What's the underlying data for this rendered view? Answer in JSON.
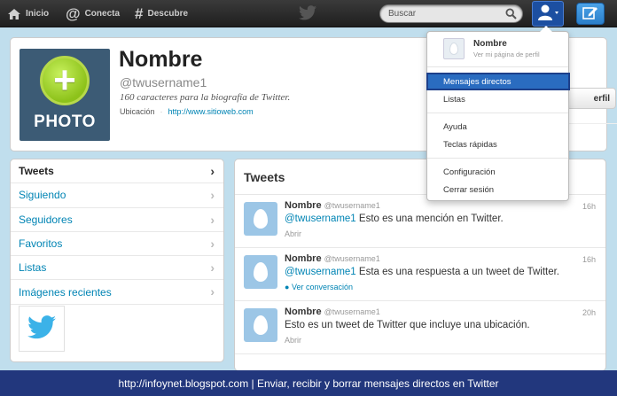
{
  "topbar": {
    "home_label": "Inicio",
    "connect_label": "Conecta",
    "discover_label": "Descubre",
    "search_placeholder": "Buscar"
  },
  "profile": {
    "name": "Nombre",
    "handle": "@twusername1",
    "bio": "160 caracteres para la biografía de Twitter.",
    "location_label": "Ubicación",
    "website": "http://www.sitioweb.com",
    "photo_text": "PHOTO",
    "edit_button": "erfil"
  },
  "sidenav": {
    "items": [
      {
        "label": "Tweets"
      },
      {
        "label": "Siguiendo"
      },
      {
        "label": "Seguidores"
      },
      {
        "label": "Favoritos"
      },
      {
        "label": "Listas"
      },
      {
        "label": "Imágenes recientes"
      }
    ]
  },
  "tweets": {
    "heading": "Tweets",
    "items": [
      {
        "name": "Nombre",
        "handle": "@twusername1",
        "mention": "@twusername1",
        "text": " Esto es una mención en Twitter.",
        "action": "Abrir",
        "time": "16h"
      },
      {
        "name": "Nombre",
        "handle": "@twusername1",
        "mention": "@twusername1",
        "text": " Esta es una respuesta a un tweet de Twitter.",
        "action": "Ver conversación",
        "time": "16h"
      },
      {
        "name": "Nombre",
        "handle": "@twusername1",
        "mention": "",
        "text": "Esto es un tweet de Twitter que incluye una ubicación.",
        "action": "Abrir",
        "time": "20h"
      }
    ]
  },
  "dropdown": {
    "profile_name": "Nombre",
    "profile_sub": "Ver mi página de perfil",
    "items": [
      {
        "label": "Mensajes directos"
      },
      {
        "label": "Listas"
      },
      {
        "label": "Ayuda"
      },
      {
        "label": "Teclas rápidas"
      },
      {
        "label": "Configuración"
      },
      {
        "label": "Cerrar sesión"
      }
    ]
  },
  "footer": {
    "text": "http://infoynet.blogspot.com | Enviar, recibir y borrar mensajes directos en Twitter"
  },
  "colors": {
    "link": "#0084b4",
    "highlight": "#2a6cc0",
    "banner": "#22377d",
    "background": "#c0deed"
  }
}
